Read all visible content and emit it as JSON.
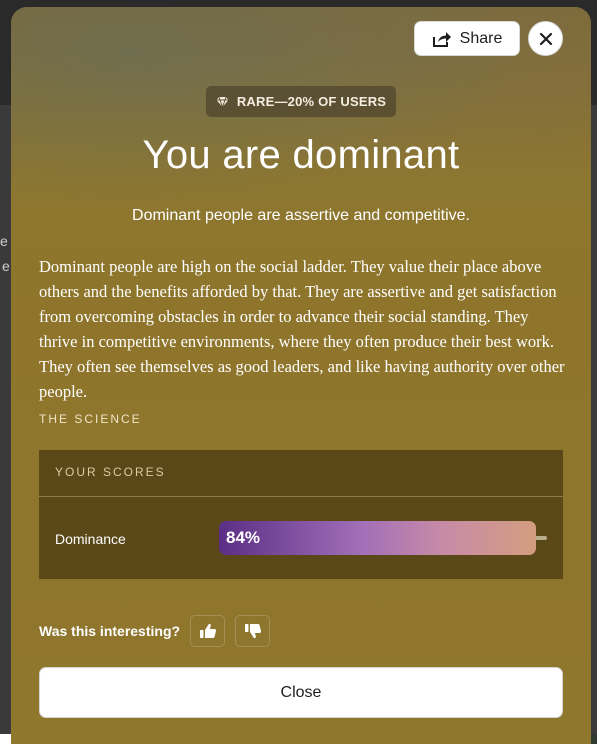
{
  "header": {
    "share_label": "Share",
    "share_icon": "share-icon",
    "close_icon": "close-icon"
  },
  "badge": {
    "icon": "gem-icon",
    "label": "RARE—20% OF USERS"
  },
  "result": {
    "title": "You are dominant",
    "subtitle": "Dominant people are assertive and competitive.",
    "description": "Dominant people are high on the social ladder. They value their place above others and the benefits afforded by that. They are assertive and get satisfaction from overcoming obstacles in order to advance their social standing. They thrive in competitive environments, where they often produce their best work. They often see themselves as good leaders, and like having authority over other people."
  },
  "science": {
    "section_label": "THE SCIENCE",
    "scores_header": "YOUR SCORES",
    "scores": [
      {
        "name": "Dominance",
        "value_label": "84%",
        "value": 0.84
      }
    ]
  },
  "feedback": {
    "question": "Was this interesting?",
    "like_icon": "thumbs-up-icon",
    "dislike_icon": "thumbs-down-icon"
  },
  "footer": {
    "close_label": "Close"
  },
  "colors": {
    "modal_bg": "#8f772d",
    "scores_bg": "#5b4819",
    "bar_gradient": [
      "#5b2f86",
      "#a26fb8",
      "#d39e80"
    ]
  }
}
